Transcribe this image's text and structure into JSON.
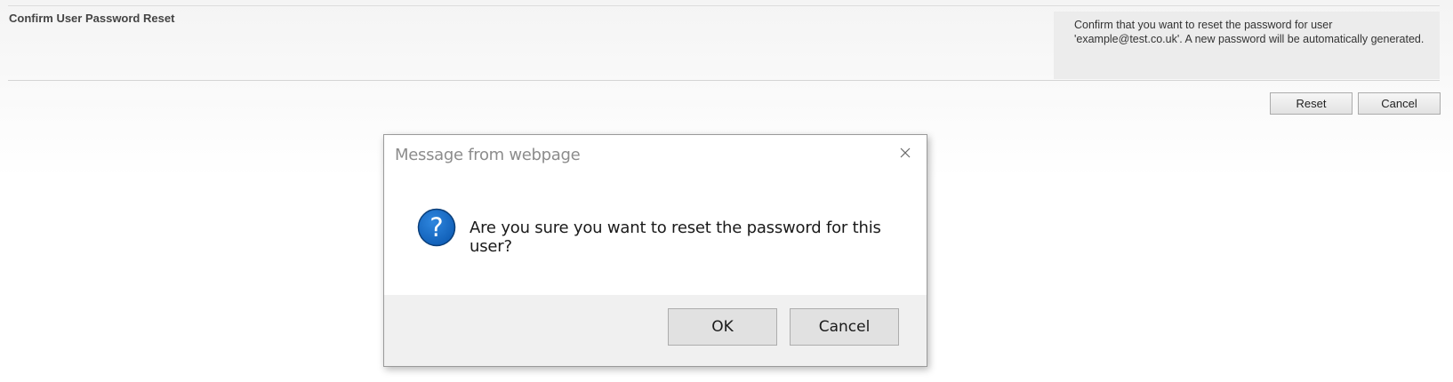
{
  "page": {
    "section_title": "Confirm User Password Reset",
    "description": "Confirm that you want to reset the password for user 'example@test.co.uk'. A new password will be automatically generated.",
    "reset_label": "Reset",
    "cancel_label": "Cancel"
  },
  "dialog": {
    "title": "Message from webpage",
    "message": "Are you sure you want to reset the password for this user?",
    "ok_label": "OK",
    "cancel_label": "Cancel",
    "icon": "question-icon",
    "close_icon": "close-icon"
  },
  "colors": {
    "question_icon": "#1565c0",
    "dialog_footer": "#f0f0f0",
    "description_bg": "#ececec"
  }
}
